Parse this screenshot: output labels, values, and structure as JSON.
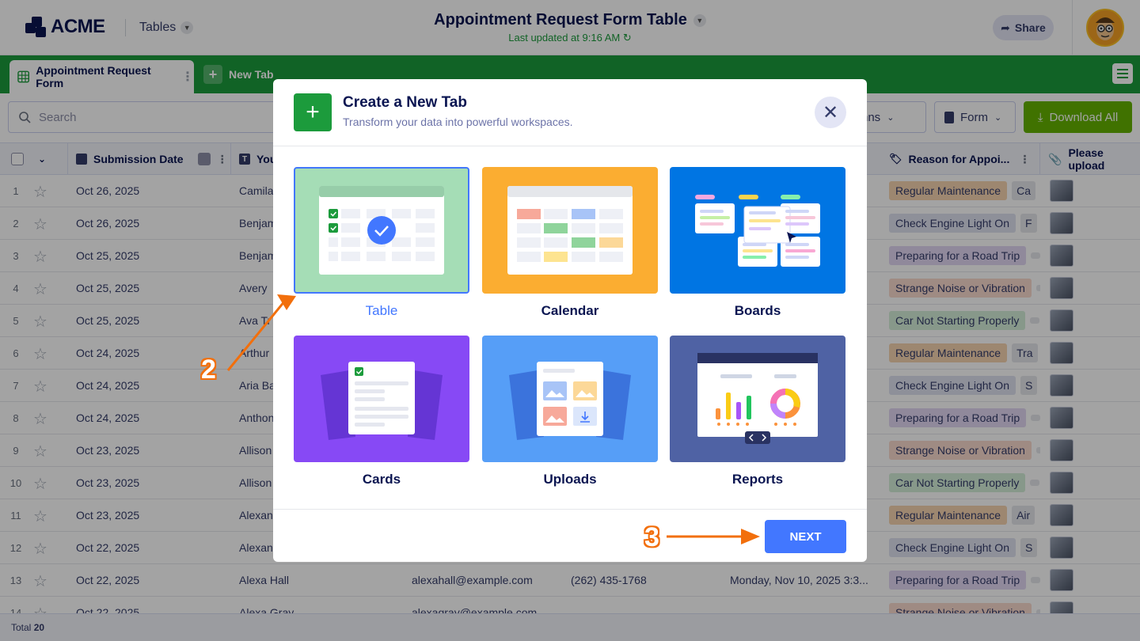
{
  "app": {
    "logo_text": "ACME",
    "tables_label": "Tables",
    "title": "Appointment Request Form Table",
    "updated": "Last updated at 9:16 AM",
    "share_label": "Share"
  },
  "tabs": {
    "active": "Appointment Request Form",
    "new_tab": "New Tab"
  },
  "toolbar": {
    "search_placeholder": "Search",
    "columns_label": "Columns",
    "form_label": "Form",
    "download_label": "Download All"
  },
  "table": {
    "headers": {
      "submission_date": "Submission Date",
      "your_name": "You",
      "reason": "Reason for Appoi...",
      "upload": "Please upload"
    },
    "rows": [
      {
        "num": "1",
        "date": "Oct 26, 2025",
        "name": "Camila",
        "tag1": "Regular Maintenance",
        "tag2": "Ca"
      },
      {
        "num": "2",
        "date": "Oct 26, 2025",
        "name": "Benjam",
        "tag1": "Check Engine Light On",
        "tag2": "F"
      },
      {
        "num": "3",
        "date": "Oct 25, 2025",
        "name": "Benjam",
        "tag1": "Preparing for a Road Trip",
        "tag2": ""
      },
      {
        "num": "4",
        "date": "Oct 25, 2025",
        "name": "Avery",
        "tag1": "Strange Noise or Vibration",
        "tag2": ""
      },
      {
        "num": "5",
        "date": "Oct 25, 2025",
        "name": "Ava Tr",
        "tag1": "Car Not Starting Properly",
        "tag2": ""
      },
      {
        "num": "6",
        "date": "Oct 24, 2025",
        "name": "Arthur",
        "tag1": "Regular Maintenance",
        "tag2": "Tra"
      },
      {
        "num": "7",
        "date": "Oct 24, 2025",
        "name": "Aria Ba",
        "tag1": "Check Engine Light On",
        "tag2": "S"
      },
      {
        "num": "8",
        "date": "Oct 24, 2025",
        "name": "Anthon",
        "tag1": "Preparing for a Road Trip",
        "tag2": ""
      },
      {
        "num": "9",
        "date": "Oct 23, 2025",
        "name": "Allison",
        "tag1": "Strange Noise or Vibration",
        "tag2": ""
      },
      {
        "num": "10",
        "date": "Oct 23, 2025",
        "name": "Allison",
        "tag1": "Car Not Starting Properly",
        "tag2": ""
      },
      {
        "num": "11",
        "date": "Oct 23, 2025",
        "name": "Alexan",
        "tag1": "Regular Maintenance",
        "tag2": "Air"
      },
      {
        "num": "12",
        "date": "Oct 22, 2025",
        "name": "Alexan",
        "tag1": "Check Engine Light On",
        "tag2": "S"
      },
      {
        "num": "13",
        "date": "Oct 22, 2025",
        "name": "Alexa Hall",
        "email": "alexahall@example.com",
        "phone": "(262) 435-1768",
        "appt": "Monday, Nov 10, 2025 3:3...",
        "tag1": "Preparing for a Road Trip",
        "tag2": ""
      },
      {
        "num": "14",
        "date": "Oct 22, 2025",
        "name": "Alexa Gray",
        "email": "alexagray@example.com",
        "tag1": "Strange Noise or Vibration",
        "tag2": ""
      }
    ],
    "total_label": "Total",
    "total_value": "20"
  },
  "tag_colors": {
    "Regular Maintenance": "#f6d4b0",
    "Check Engine Light On": "#dfe1f0",
    "Preparing for a Road Trip": "#e1d6f3",
    "Strange Noise or Vibration": "#f9d9cd",
    "Car Not Starting Properly": "#d3eed8"
  },
  "modal": {
    "title": "Create a New Tab",
    "subtitle": "Transform your data into powerful workspaces.",
    "options": [
      {
        "label": "Table",
        "color": "#a5ddb6"
      },
      {
        "label": "Calendar",
        "color": "#fbad31"
      },
      {
        "label": "Boards",
        "color": "#0075e3"
      },
      {
        "label": "Cards",
        "color": "#8749f5"
      },
      {
        "label": "Uploads",
        "color": "#569ef7"
      },
      {
        "label": "Reports",
        "color": "#4f62a4"
      }
    ],
    "next_label": "NEXT"
  },
  "callouts": {
    "step2": "2",
    "step3": "3"
  }
}
